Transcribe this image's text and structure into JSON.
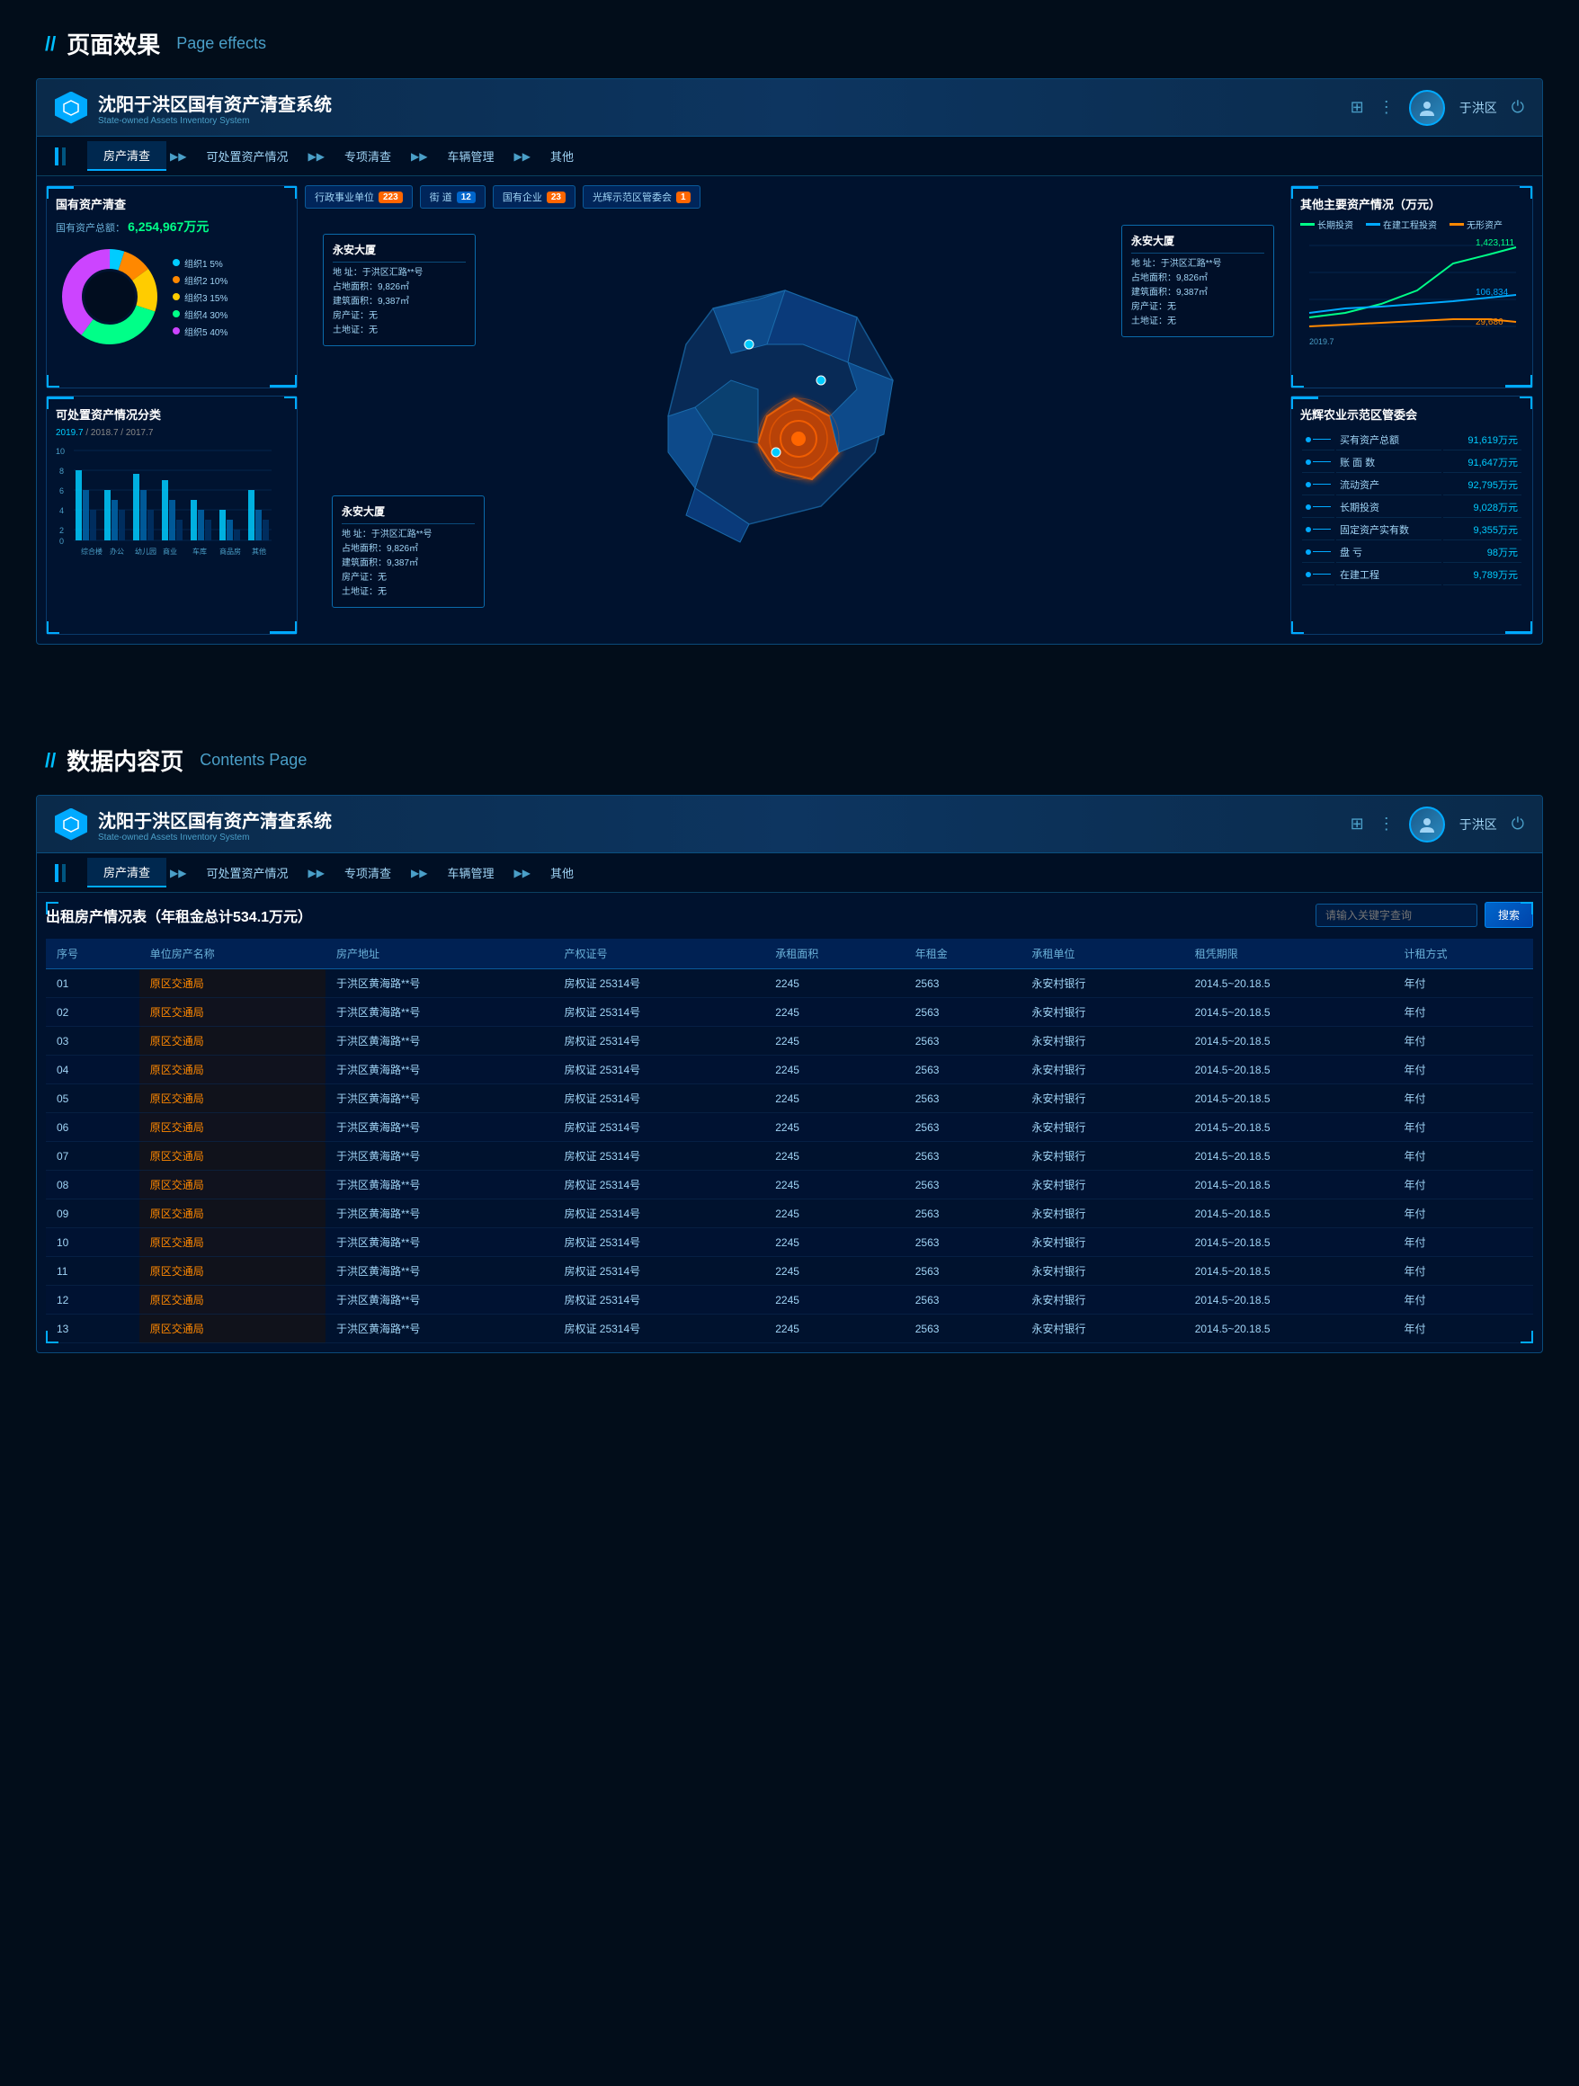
{
  "section1": {
    "title_cn": "页面效果",
    "title_en": "Page effects"
  },
  "section2": {
    "title_cn": "数据内容页",
    "title_en": "Contents Page"
  },
  "system": {
    "title": "沈阳于洪区国有资产清查系统",
    "subtitle": "State-owned Assets Inventory System",
    "user_label": "于洪区"
  },
  "nav": {
    "items": [
      {
        "label": "房产清查",
        "active": true
      },
      {
        "label": "可处置资产情况",
        "active": false
      },
      {
        "label": "专项清查",
        "active": false
      },
      {
        "label": "车辆管理",
        "active": false
      },
      {
        "label": "其他",
        "active": false
      }
    ]
  },
  "filter_bar": {
    "items": [
      {
        "label": "行政事业单位",
        "count": "223",
        "count_color": "orange"
      },
      {
        "label": "街 道",
        "count": "12",
        "count_color": "blue"
      },
      {
        "label": "国有企业",
        "count": "23",
        "count_color": "orange"
      },
      {
        "label": "光辉示范区管委会",
        "count": "1",
        "count_color": "orange"
      }
    ]
  },
  "left_panel": {
    "asset_check": {
      "title": "国有资产清查",
      "subtitle": "国有资产总额：",
      "total": "6,254,967万元",
      "legend": [
        {
          "label": "组织1  5%",
          "color": "#00ccff",
          "percent": 5
        },
        {
          "label": "组织2  10%",
          "color": "#ff8800",
          "percent": 10
        },
        {
          "label": "组织3  15%",
          "color": "#ffcc00",
          "percent": 15
        },
        {
          "label": "组织4  30%",
          "color": "#00ff88",
          "percent": 30
        },
        {
          "label": "组织5  40%",
          "color": "#cc44ff",
          "percent": 40
        }
      ]
    },
    "disposal": {
      "title": "可处置资产情况分类",
      "years": "2019.7 / 2018.7 / 2017.7",
      "y_labels": [
        "10",
        "8",
        "6",
        "4",
        "2",
        "0"
      ],
      "bars": [
        {
          "label": "综合楼",
          "values": [
            8,
            6,
            4
          ]
        },
        {
          "label": "办公",
          "values": [
            5,
            4,
            3
          ]
        },
        {
          "label": "幼儿园",
          "values": [
            7,
            5,
            3
          ]
        },
        {
          "label": "商业",
          "values": [
            6,
            4,
            2
          ]
        },
        {
          "label": "车库",
          "values": [
            4,
            3,
            2
          ]
        },
        {
          "label": "商品房",
          "values": [
            3,
            2,
            1
          ]
        },
        {
          "label": "其他",
          "values": [
            5,
            3,
            2
          ]
        }
      ]
    }
  },
  "map_popups": {
    "popup1": {
      "title": "永安大厦",
      "lines": [
        "地  址：于洪区汇路**号",
        "占地面积：9,826㎡",
        "建筑面积：9,387㎡",
        "房产证：无",
        "土地证：无"
      ]
    },
    "popup2": {
      "title": "永安大厦",
      "lines": [
        "地  址：于洪区汇路**号",
        "占地面积：9,826㎡",
        "建筑面积：9,387㎡",
        "房产证：无",
        "土地证：无"
      ]
    },
    "popup3": {
      "title": "永安大厦",
      "lines": [
        "地  址：于洪区汇路**号",
        "占地面积：9,826㎡",
        "建筑面积：9,387㎡",
        "房产证：无",
        "土地证：无"
      ]
    }
  },
  "right_panel": {
    "main_assets": {
      "title": "其他主要资产情况（万元）",
      "legend": [
        {
          "label": "长期投资",
          "color": "#00ff88"
        },
        {
          "label": "在建工程投资",
          "color": "#00aaff"
        },
        {
          "label": "无形资产",
          "color": "#ff8800"
        }
      ],
      "values": {
        "top": "1,423,111",
        "mid": "106,834",
        "bottom": "29,686"
      },
      "year": "2019.7"
    },
    "committee": {
      "title": "光辉农业示范区管委会",
      "rows": [
        {
          "label": "买有资产总额",
          "value": "91,619万元"
        },
        {
          "label": "账 面 数",
          "value": "91,647万元"
        },
        {
          "label": "流动资产",
          "value": "92,795万元"
        },
        {
          "label": "长期投资",
          "value": "9,028万元"
        },
        {
          "label": "固定资产实有数",
          "value": "9,355万元"
        },
        {
          "label": "盘  亏",
          "value": "98万元"
        },
        {
          "label": "在建工程",
          "value": "9,789万元"
        }
      ]
    }
  },
  "data_table": {
    "title": "出租房产情况表（年租金总计534.1万元）",
    "search_placeholder": "请输入关键字查询",
    "search_btn": "搜索",
    "columns": [
      "序号",
      "单位房产名称",
      "房产地址",
      "产权证号",
      "承租面积",
      "年租金",
      "承租单位",
      "租凭期限",
      "计租方式"
    ],
    "rows": [
      {
        "seq": "01",
        "name": "原区交通局",
        "addr": "于洪区黄海路**号",
        "cert": "房权证 25314号",
        "area": "2245",
        "rent": "2563",
        "tenant": "永安村银行",
        "period": "2014.5~20.18.5",
        "method": "年付"
      },
      {
        "seq": "02",
        "name": "原区交通局",
        "addr": "于洪区黄海路**号",
        "cert": "房权证 25314号",
        "area": "2245",
        "rent": "2563",
        "tenant": "永安村银行",
        "period": "2014.5~20.18.5",
        "method": "年付"
      },
      {
        "seq": "03",
        "name": "原区交通局",
        "addr": "于洪区黄海路**号",
        "cert": "房权证 25314号",
        "area": "2245",
        "rent": "2563",
        "tenant": "永安村银行",
        "period": "2014.5~20.18.5",
        "method": "年付"
      },
      {
        "seq": "04",
        "name": "原区交通局",
        "addr": "于洪区黄海路**号",
        "cert": "房权证 25314号",
        "area": "2245",
        "rent": "2563",
        "tenant": "永安村银行",
        "period": "2014.5~20.18.5",
        "method": "年付"
      },
      {
        "seq": "05",
        "name": "原区交通局",
        "addr": "于洪区黄海路**号",
        "cert": "房权证 25314号",
        "area": "2245",
        "rent": "2563",
        "tenant": "永安村银行",
        "period": "2014.5~20.18.5",
        "method": "年付"
      },
      {
        "seq": "06",
        "name": "原区交通局",
        "addr": "于洪区黄海路**号",
        "cert": "房权证 25314号",
        "area": "2245",
        "rent": "2563",
        "tenant": "永安村银行",
        "period": "2014.5~20.18.5",
        "method": "年付"
      },
      {
        "seq": "07",
        "name": "原区交通局",
        "addr": "于洪区黄海路**号",
        "cert": "房权证 25314号",
        "area": "2245",
        "rent": "2563",
        "tenant": "永安村银行",
        "period": "2014.5~20.18.5",
        "method": "年付"
      },
      {
        "seq": "08",
        "name": "原区交通局",
        "addr": "于洪区黄海路**号",
        "cert": "房权证 25314号",
        "area": "2245",
        "rent": "2563",
        "tenant": "永安村银行",
        "period": "2014.5~20.18.5",
        "method": "年付"
      },
      {
        "seq": "09",
        "name": "原区交通局",
        "addr": "于洪区黄海路**号",
        "cert": "房权证 25314号",
        "area": "2245",
        "rent": "2563",
        "tenant": "永安村银行",
        "period": "2014.5~20.18.5",
        "method": "年付"
      },
      {
        "seq": "10",
        "name": "原区交通局",
        "addr": "于洪区黄海路**号",
        "cert": "房权证 25314号",
        "area": "2245",
        "rent": "2563",
        "tenant": "永安村银行",
        "period": "2014.5~20.18.5",
        "method": "年付"
      },
      {
        "seq": "11",
        "name": "原区交通局",
        "addr": "于洪区黄海路**号",
        "cert": "房权证 25314号",
        "area": "2245",
        "rent": "2563",
        "tenant": "永安村银行",
        "period": "2014.5~20.18.5",
        "method": "年付"
      },
      {
        "seq": "12",
        "name": "原区交通局",
        "addr": "于洪区黄海路**号",
        "cert": "房权证 25314号",
        "area": "2245",
        "rent": "2563",
        "tenant": "永安村银行",
        "period": "2014.5~20.18.5",
        "method": "年付"
      },
      {
        "seq": "13",
        "name": "原区交通局",
        "addr": "于洪区黄海路**号",
        "cert": "房权证 25314号",
        "area": "2245",
        "rent": "2563",
        "tenant": "永安村银行",
        "period": "2014.5~20.18.5",
        "method": "年付"
      }
    ]
  }
}
